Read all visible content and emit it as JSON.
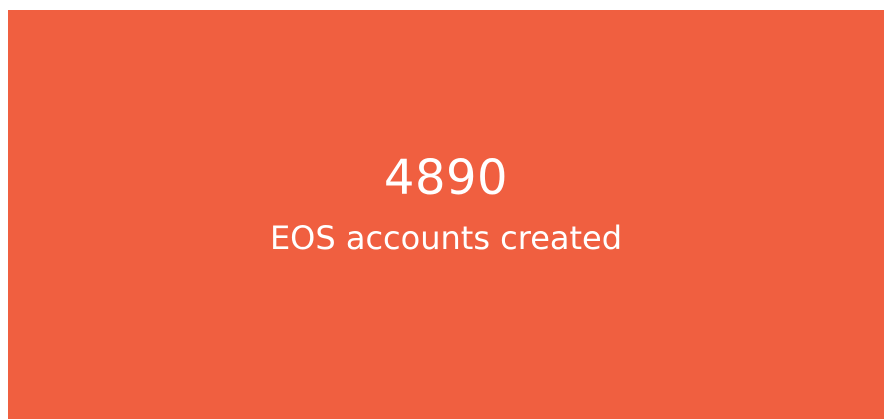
{
  "stat_card": {
    "value": "4890",
    "label": "EOS accounts created",
    "background_color": "#f05f40",
    "text_color": "#ffffff"
  }
}
